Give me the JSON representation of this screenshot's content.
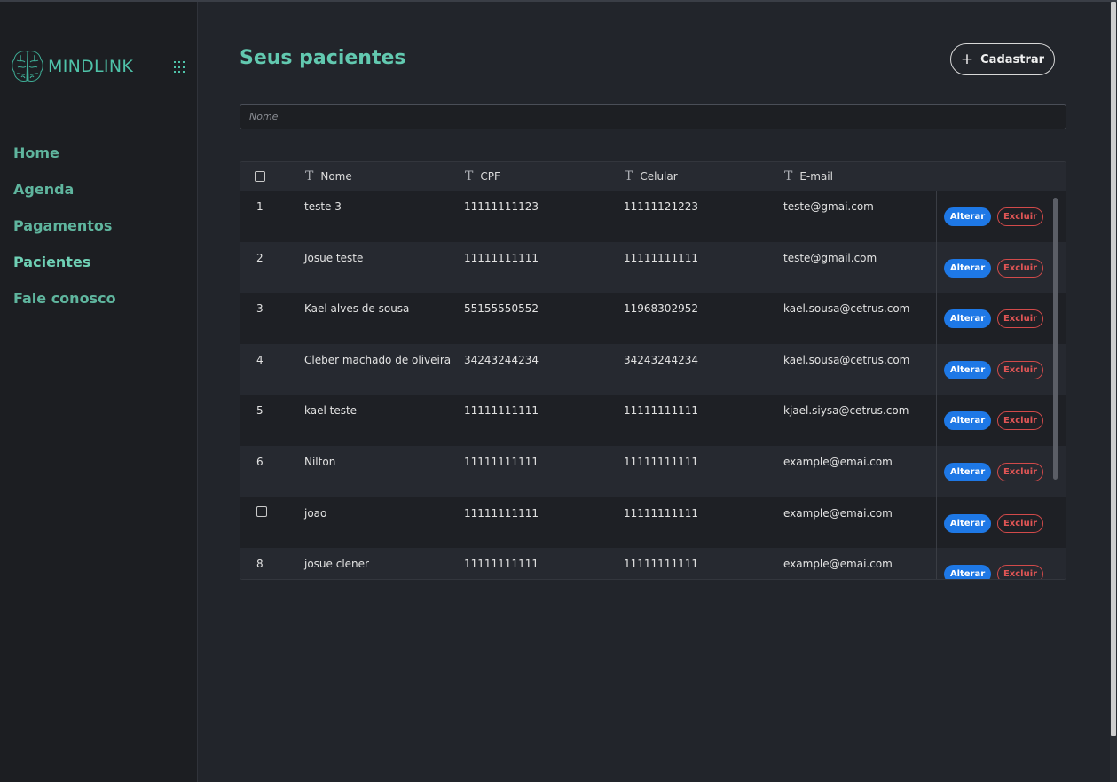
{
  "app": {
    "name": "MINDLINK"
  },
  "sidebar": {
    "items": [
      {
        "label": "Home"
      },
      {
        "label": "Agenda"
      },
      {
        "label": "Pagamentos"
      },
      {
        "label": "Pacientes",
        "active": true
      },
      {
        "label": "Fale conosco"
      }
    ]
  },
  "header": {
    "title": "Seus pacientes",
    "cadastrar_label": "Cadastrar"
  },
  "search": {
    "placeholder": "Nome",
    "value": ""
  },
  "table": {
    "columns": [
      "Nome",
      "CPF",
      "Celular",
      "E-mail"
    ],
    "actions": {
      "edit_label": "Alterar",
      "delete_label": "Excluir"
    },
    "rows": [
      {
        "index": "1",
        "nome": "teste 3",
        "cpf": "11111111123",
        "celular": "11111121223",
        "email": "teste@gmai.com"
      },
      {
        "index": "2",
        "nome": "Josue teste",
        "cpf": "11111111111",
        "celular": "11111111111",
        "email": "teste@gmail.com"
      },
      {
        "index": "3",
        "nome": "Kael alves de sousa",
        "cpf": "55155550552",
        "celular": "11968302952",
        "email": "kael.sousa@cetrus.com"
      },
      {
        "index": "4",
        "nome": "Cleber machado de oliveira",
        "cpf": "34243244234",
        "celular": "34243244234",
        "email": "kael.sousa@cetrus.com"
      },
      {
        "index": "5",
        "nome": "kael teste",
        "cpf": "11111111111",
        "celular": "11111111111",
        "email": "kjael.siysa@cetrus.com"
      },
      {
        "index": "6",
        "nome": "Nilton",
        "cpf": "11111111111",
        "celular": "11111111111",
        "email": "example@emai.com"
      },
      {
        "index": "",
        "nome": "joao",
        "cpf": "11111111111",
        "celular": "11111111111",
        "email": "example@emai.com",
        "checkbox": true
      },
      {
        "index": "8",
        "nome": "josue clener",
        "cpf": "11111111111",
        "celular": "11111111111",
        "email": "example@emai.com"
      }
    ]
  },
  "colors": {
    "accent": "#5fb59e",
    "primary_button": "#1e78e6",
    "danger": "#e05555"
  }
}
